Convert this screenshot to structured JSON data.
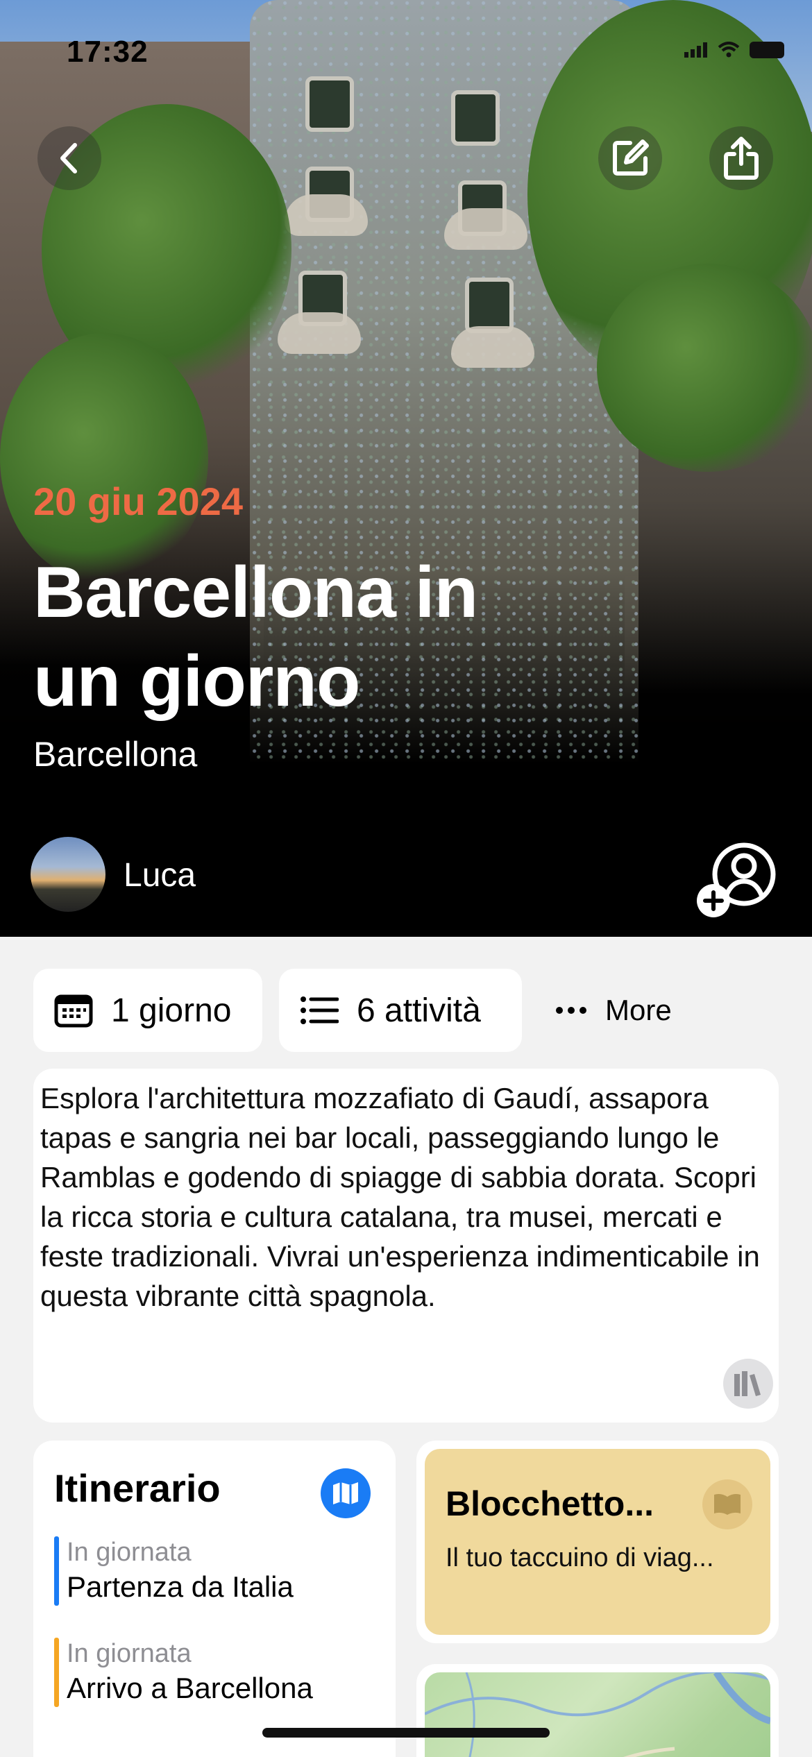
{
  "status_bar": {
    "time": "17:32"
  },
  "hero": {
    "date": "20 giu 2024",
    "title": "Barcellona in un giorno",
    "city": "Barcellona",
    "author": "Luca"
  },
  "chips": {
    "duration": "1 giorno",
    "activities": "6 attività",
    "more": "More"
  },
  "description": "Esplora l'architettura mozzafiato di Gaudí, assapora tapas e sangria nei bar locali, passeggiando lungo le Ramblas e godendo di spiagge di sabbia dorata. Scopri la ricca storia e cultura catalana, tra musei, mercati e feste tradizionali. Vivrai un'esperienza indimenticabile in questa vibrante città spagnola.",
  "itinerary": {
    "title": "Itinerario",
    "items": [
      {
        "when": "In giornata",
        "what": "Partenza da Italia",
        "color": "#1a7cf5"
      },
      {
        "when": "In giornata",
        "what": "Arrivo a Barcellona",
        "color": "#f5a623"
      }
    ]
  },
  "notebook": {
    "title": "Blocchetto...",
    "subtitle": "Il tuo taccuino di viag..."
  },
  "colors": {
    "accent_date": "#ee6a45",
    "map_button": "#1a7cf5",
    "notebook_bg": "#f0d99c"
  }
}
